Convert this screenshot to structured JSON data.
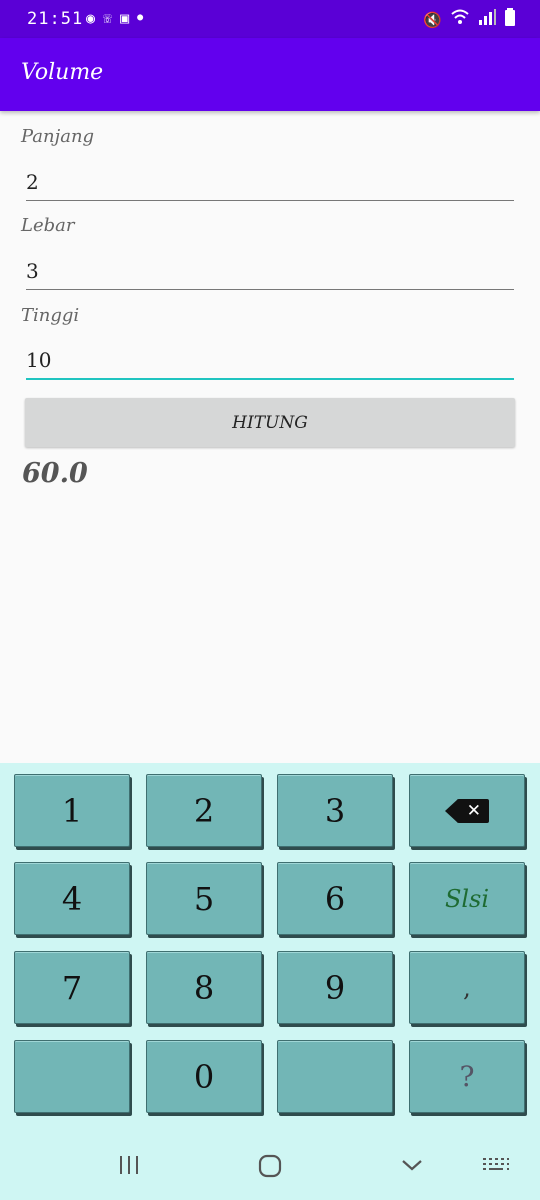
{
  "status_bar": {
    "time": "21:51",
    "left_icons": [
      "record-icon",
      "whatsapp-icon",
      "battery-saver-icon",
      "dot-icon"
    ],
    "right_icons": [
      "mute-icon",
      "wifi-icon",
      "signal-icon",
      "battery-icon"
    ]
  },
  "app_bar": {
    "title": "Volume"
  },
  "form": {
    "panjang": {
      "label": "Panjang",
      "value": "2"
    },
    "lebar": {
      "label": "Lebar",
      "value": "3"
    },
    "tinggi": {
      "label": "Tinggi",
      "value": "10"
    },
    "button_label": "HITUNG",
    "result": "60.0"
  },
  "keyboard": {
    "keys": [
      "1",
      "2",
      "3",
      "backspace",
      "4",
      "5",
      "6",
      "Slsi",
      "7",
      "8",
      "9",
      ",",
      "",
      "0",
      "",
      "?"
    ]
  },
  "nav_bar": {
    "icons": [
      "recent-apps-icon",
      "home-icon",
      "back-icon",
      "keyboard-switch-icon"
    ]
  },
  "colors": {
    "app_bar": "#6200ee",
    "status_bar": "#5a00d6",
    "accent": "#1fc4c0",
    "keyboard_bg": "#cff6f3",
    "key": "#72b6b6"
  }
}
